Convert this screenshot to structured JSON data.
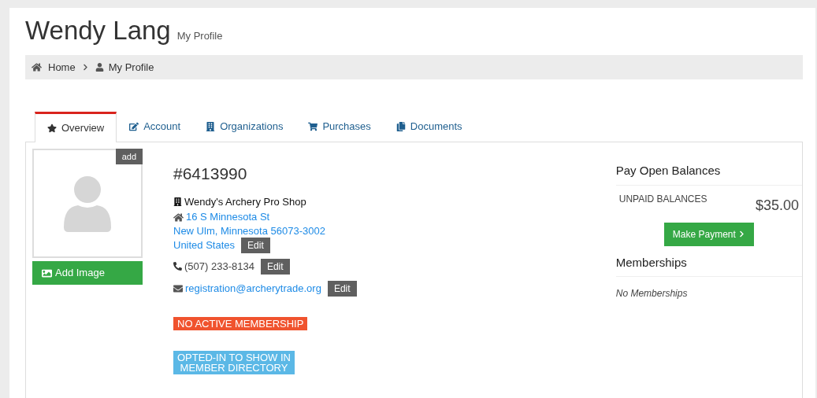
{
  "header": {
    "title": "Wendy Lang",
    "subtitle": "My Profile"
  },
  "breadcrumb": [
    {
      "label": "Home"
    },
    {
      "label": "My Profile"
    }
  ],
  "tabs": [
    {
      "label": "Overview",
      "selected": true
    },
    {
      "label": "Account",
      "selected": false
    },
    {
      "label": "Organizations",
      "selected": false
    },
    {
      "label": "Purchases",
      "selected": false
    },
    {
      "label": "Documents",
      "selected": false
    }
  ],
  "photo": {
    "add_label": "add",
    "button": "Add Image"
  },
  "profile": {
    "member_number": "#6413990",
    "organization": "Wendy's Archery Pro Shop",
    "address": {
      "lines": [
        "16 S Minnesota St",
        "New Ulm, Minnesota 56073-3002",
        "United States"
      ],
      "edit": "Edit"
    },
    "phone": {
      "text": "(507) 233-8134",
      "edit": "Edit"
    },
    "email": {
      "text": "registration@archerytrade.org",
      "edit": "Edit"
    },
    "badges": [
      {
        "kind": "warning",
        "lines": [
          "NO ACTIVE MEMBERSHIP"
        ]
      },
      {
        "kind": "info",
        "lines": [
          "OPTED-IN TO SHOW IN",
          "MEMBER DIRECTORY"
        ]
      }
    ]
  },
  "balances": {
    "title": "Pay Open Balances",
    "label": "UNPAID BALANCES",
    "amount": "$35.00",
    "button": "Make Payment"
  },
  "memberships": {
    "title": "Memberships",
    "empty": "No Memberships"
  }
}
